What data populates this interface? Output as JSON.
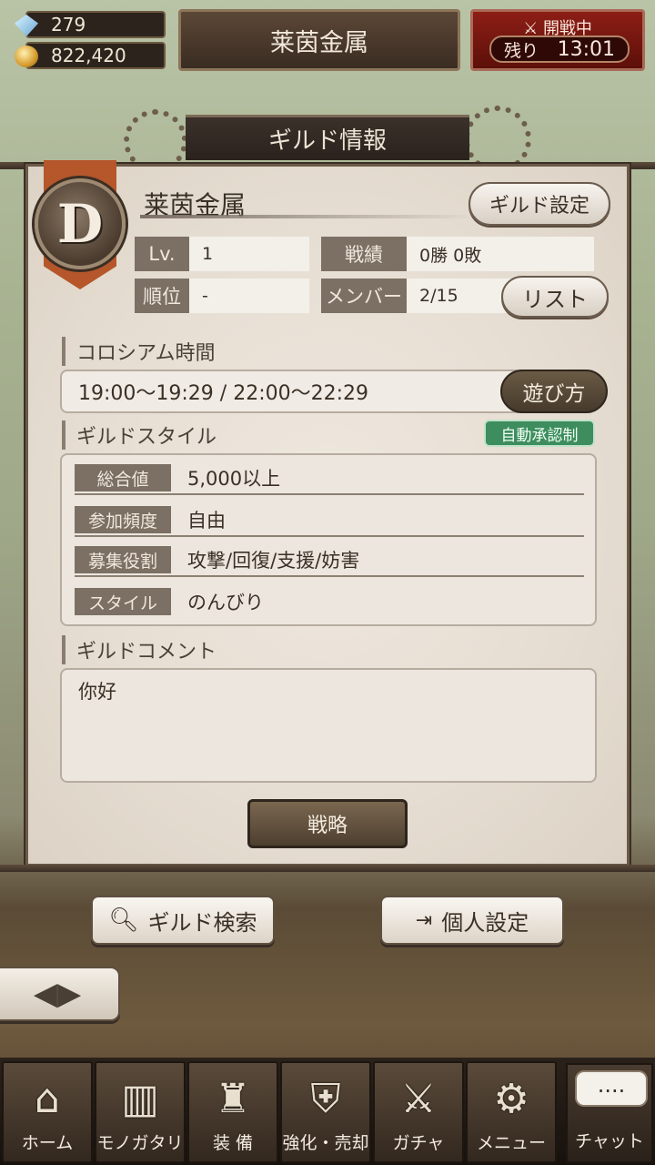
{
  "status": {
    "gems": "279",
    "coins": "822,420"
  },
  "title": "莱茵金属",
  "battle": {
    "status": "開戦中",
    "remaining_label": "残り",
    "remaining_time": "13:01"
  },
  "panel": {
    "header": "ギルド情報",
    "emblem_letter": "D",
    "guild_name": "莱茵金属",
    "settings_button": "ギルド設定",
    "stats": {
      "level_label": "Lv.",
      "level_value": "1",
      "record_label": "戦績",
      "record_value": "0勝 0敗",
      "rank_label": "順位",
      "rank_value": "-",
      "members_label": "メンバー",
      "members_value": "2/15",
      "list_button": "リスト"
    },
    "colosseum": {
      "title": "コロシアム時間",
      "time": "19:00〜19:29 / 22:00〜22:29",
      "howto_button": "遊び方"
    },
    "style": {
      "title": "ギルドスタイル",
      "auto_badge": "自動承認制",
      "rows": [
        {
          "label": "総合値",
          "value": "5,000以上"
        },
        {
          "label": "参加頻度",
          "value": "自由"
        },
        {
          "label": "募集役割",
          "value": "攻撃/回復/支援/妨害"
        },
        {
          "label": "スタイル",
          "value": "のんびり"
        }
      ]
    },
    "comment": {
      "title": "ギルドコメント",
      "text": "你好"
    },
    "strategy_button": "戦略"
  },
  "floor": {
    "search_button": "ギルド検索",
    "personal_button": "個人設定"
  },
  "nav": {
    "items": [
      {
        "label": "ホーム",
        "icon": "home-icon"
      },
      {
        "label": "モノガタリ",
        "icon": "book-icon"
      },
      {
        "label": "装 備",
        "icon": "equipment-icon"
      },
      {
        "label": "強化・売却",
        "icon": "enhance-icon"
      },
      {
        "label": "ガチャ",
        "icon": "sword-icon"
      },
      {
        "label": "メニュー",
        "icon": "gear-icon"
      }
    ],
    "chat_label": "チャット",
    "chat_bubble": "...."
  }
}
